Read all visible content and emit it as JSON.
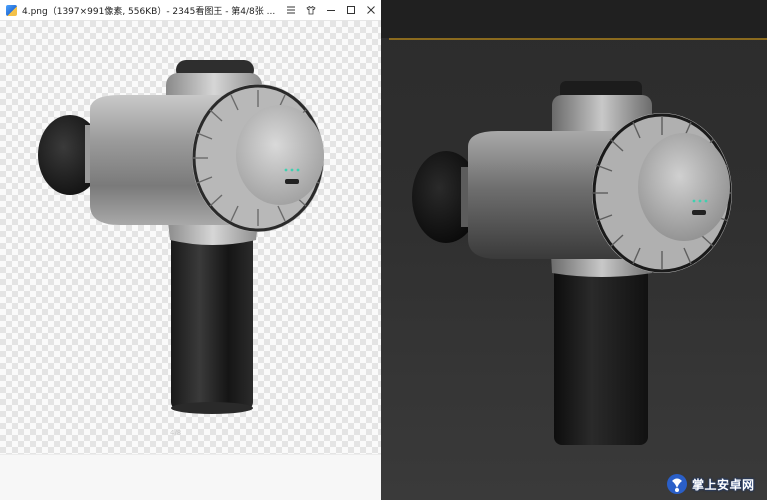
{
  "window": {
    "title": "4.png（1397×991像素, 556KB）- 2345看图王 - 第4/8张 ...",
    "page_indicator": "4/8"
  },
  "toolbar": {
    "buttons": [
      {
        "name": "menu-icon"
      },
      {
        "name": "skin-icon"
      },
      {
        "name": "minimize-icon"
      },
      {
        "name": "maximize-icon"
      },
      {
        "name": "close-icon"
      }
    ]
  },
  "images": {
    "left_product": "massage-gun-product-image",
    "right_product": "massage-gun-3d-render"
  },
  "watermark": {
    "text": "掌上安卓网",
    "logo_icon": "wm-logo-icon"
  },
  "colors": {
    "viewport_bg": "#2e2e2e",
    "viewport_accent_line": "#8a6a1e",
    "status_led": "#3fd0b0"
  }
}
